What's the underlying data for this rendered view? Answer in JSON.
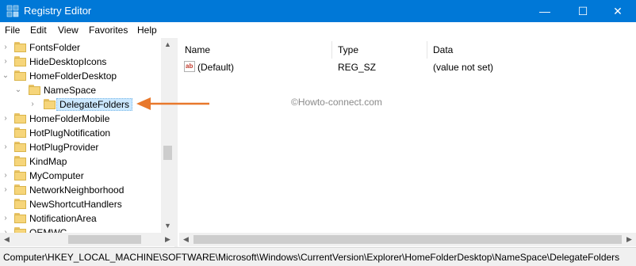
{
  "window": {
    "title": "Registry Editor"
  },
  "window_controls": {
    "minimize": "—",
    "maximize": "☐",
    "close": "✕"
  },
  "menu": [
    "File",
    "Edit",
    "View",
    "Favorites",
    "Help"
  ],
  "tree": {
    "items": [
      {
        "label": "FontsFolder",
        "expander": "›"
      },
      {
        "label": "HideDesktopIcons",
        "expander": "›"
      },
      {
        "label": "HomeFolderDesktop",
        "expander": "⌄"
      },
      {
        "label": "NameSpace",
        "expander": "⌄"
      },
      {
        "label": "DelegateFolders",
        "expander": "›",
        "selected": true
      },
      {
        "label": "HomeFolderMobile",
        "expander": "›"
      },
      {
        "label": "HotPlugNotification",
        "expander": ""
      },
      {
        "label": "HotPlugProvider",
        "expander": "›"
      },
      {
        "label": "KindMap",
        "expander": ""
      },
      {
        "label": "MyComputer",
        "expander": "›"
      },
      {
        "label": "NetworkNeighborhood",
        "expander": "›"
      },
      {
        "label": "NewShortcutHandlers",
        "expander": ""
      },
      {
        "label": "NotificationArea",
        "expander": "›"
      },
      {
        "label": "OEMWC",
        "expander": "›"
      }
    ]
  },
  "list": {
    "columns": [
      "Name",
      "Type",
      "Data"
    ],
    "rows": [
      {
        "icon": "string-value-icon",
        "icon_text": "ab",
        "name": "(Default)",
        "type": "REG_SZ",
        "data": "(value not set)"
      }
    ]
  },
  "watermark": "©Howto-connect.com",
  "scroll_glyphs": {
    "up": "▲",
    "down": "▼",
    "left": "◀",
    "right": "▶"
  },
  "statusbar": {
    "path": "Computer\\HKEY_LOCAL_MACHINE\\SOFTWARE\\Microsoft\\Windows\\CurrentVersion\\Explorer\\HomeFolderDesktop\\NameSpace\\DelegateFolders"
  },
  "colors": {
    "titlebar": "#0078d7",
    "annotation_arrow": "#e8782c",
    "selection": "#cce8ff"
  }
}
